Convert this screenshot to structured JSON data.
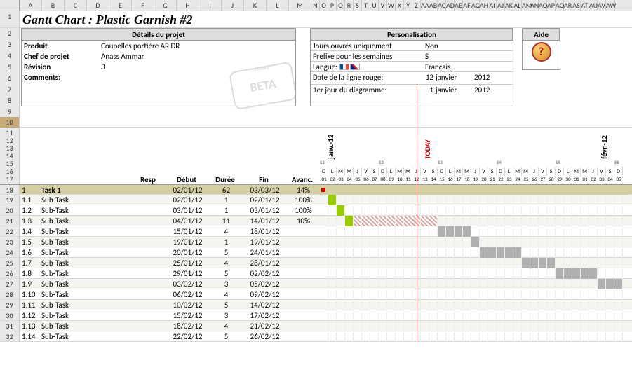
{
  "colHeaders": [
    "A",
    "B",
    "C",
    "D",
    "E",
    "F",
    "G",
    "H",
    "I",
    "J",
    "K",
    "L",
    "M",
    "N",
    "O",
    "P",
    "Q",
    "R",
    "S",
    "T",
    "U",
    "V",
    "W",
    "X",
    "Y",
    "Z",
    "AA",
    "AB",
    "AC",
    "AD",
    "AE",
    "AF",
    "AG",
    "AH",
    "AI",
    "AJ",
    "AK",
    "AL",
    "AM",
    "AN",
    "AO",
    "AP",
    "AQ",
    "AR",
    "AS",
    "AT",
    "AU",
    "AV",
    "AW"
  ],
  "title": "Gantt Chart : Plastic Garnish #2",
  "details": {
    "header": "Détails du projet",
    "product_label": "Produit",
    "product_value": "Coupelles portière AR DR",
    "pm_label": "Chef de projet",
    "pm_value": "Anass Ammar",
    "rev_label": "Révision",
    "rev_value": "3",
    "comments_label": "Comments:"
  },
  "personal": {
    "header": "Personalisation",
    "workdays_label": "Jours ouvrés uniquement",
    "workdays_value": "Non",
    "prefix_label": "Prefixe pour les semaines",
    "prefix_value": "S",
    "lang_label": "Langue:",
    "lang_value": "Français",
    "redline_label": "Date de la ligne rouge:",
    "redline_day": "12",
    "redline_month": "janvier",
    "redline_year": "2012",
    "firstday_label": "1er jour du diagramme:",
    "firstday_day": "1",
    "firstday_month": "janvier",
    "firstday_year": "2012"
  },
  "help": {
    "header": "Aide"
  },
  "betaStamp": "BETA",
  "ganttHeaders": {
    "resp": "Resp",
    "debut": "Début",
    "duree": "Durée",
    "fin": "Fin",
    "avanc": "Avanc."
  },
  "months": {
    "jan": "janv.-12",
    "today": "TODAY",
    "feb": "févr.-12"
  },
  "weekdays": [
    "D",
    "L",
    "M",
    "M",
    "J",
    "V",
    "S"
  ],
  "tasks": [
    {
      "row": 18,
      "idx": "1",
      "name": "Task 1",
      "debut": "02/01/12",
      "duree": "62",
      "fin": "03/03/12",
      "avanc": "14%",
      "header": true
    },
    {
      "row": 19,
      "idx": "1.1",
      "name": "Sub-Task",
      "debut": "02/01/12",
      "duree": "1",
      "fin": "02/01/12",
      "avanc": "100%",
      "barStart": 1,
      "barLen": 1,
      "barType": "green"
    },
    {
      "row": 20,
      "idx": "1.2",
      "name": "Sub-Task",
      "debut": "03/01/12",
      "duree": "1",
      "fin": "03/01/12",
      "avanc": "100%",
      "barStart": 2,
      "barLen": 1,
      "barType": "green"
    },
    {
      "row": 21,
      "idx": "1.3",
      "name": "Sub-Task",
      "debut": "04/01/12",
      "duree": "11",
      "fin": "14/01/12",
      "avanc": "10%",
      "barStart": 3,
      "barLen": 1,
      "barType": "green",
      "bar2Start": 4,
      "bar2Len": 10,
      "bar2Type": "stripe"
    },
    {
      "row": 22,
      "idx": "1.4",
      "name": "Sub-Task",
      "debut": "15/01/12",
      "duree": "4",
      "fin": "18/01/12",
      "avanc": "",
      "barStart": 14,
      "barLen": 4,
      "barType": "gray"
    },
    {
      "row": 23,
      "idx": "1.5",
      "name": "Sub-Task",
      "debut": "19/01/12",
      "duree": "1",
      "fin": "19/01/12",
      "avanc": "",
      "barStart": 18,
      "barLen": 1,
      "barType": "gray"
    },
    {
      "row": 24,
      "idx": "1.6",
      "name": "Sub-Task",
      "debut": "20/01/12",
      "duree": "5",
      "fin": "24/01/12",
      "avanc": "",
      "barStart": 19,
      "barLen": 5,
      "barType": "gray"
    },
    {
      "row": 25,
      "idx": "1.7",
      "name": "Sub-Task",
      "debut": "25/01/12",
      "duree": "4",
      "fin": "28/01/12",
      "avanc": "",
      "barStart": 24,
      "barLen": 4,
      "barType": "gray"
    },
    {
      "row": 26,
      "idx": "1.8",
      "name": "Sub-Task",
      "debut": "29/01/12",
      "duree": "5",
      "fin": "02/02/12",
      "avanc": "",
      "barStart": 28,
      "barLen": 5,
      "barType": "gray"
    },
    {
      "row": 27,
      "idx": "1.9",
      "name": "Sub-Task",
      "debut": "03/02/12",
      "duree": "3",
      "fin": "05/02/12",
      "avanc": "",
      "barStart": 33,
      "barLen": 3,
      "barType": "gray"
    },
    {
      "row": 28,
      "idx": "1.10",
      "name": "Sub-Task",
      "debut": "06/02/12",
      "duree": "4",
      "fin": "09/02/12",
      "avanc": ""
    },
    {
      "row": 29,
      "idx": "1.11",
      "name": "Sub-Task",
      "debut": "10/02/12",
      "duree": "5",
      "fin": "14/02/12",
      "avanc": ""
    },
    {
      "row": 30,
      "idx": "1.12",
      "name": "Sub-Task",
      "debut": "15/02/12",
      "duree": "3",
      "fin": "17/02/12",
      "avanc": ""
    },
    {
      "row": 31,
      "idx": "1.13",
      "name": "Sub-Task",
      "debut": "18/02/12",
      "duree": "4",
      "fin": "21/02/12",
      "avanc": ""
    },
    {
      "row": 32,
      "idx": "1.14",
      "name": "Sub-Task",
      "debut": "22/02/12",
      "duree": "5",
      "fin": "26/02/12",
      "avanc": ""
    }
  ],
  "chart_data": {
    "type": "gantt",
    "title": "Gantt Chart : Plastic Garnish #2",
    "start_date": "01/01/2012",
    "today_date": "12/01/2012",
    "tasks": [
      {
        "id": "1",
        "name": "Task 1",
        "start": "02/01/12",
        "duration": 62,
        "end": "03/03/12",
        "progress": 0.14
      },
      {
        "id": "1.1",
        "name": "Sub-Task",
        "start": "02/01/12",
        "duration": 1,
        "end": "02/01/12",
        "progress": 1.0
      },
      {
        "id": "1.2",
        "name": "Sub-Task",
        "start": "03/01/12",
        "duration": 1,
        "end": "03/01/12",
        "progress": 1.0
      },
      {
        "id": "1.3",
        "name": "Sub-Task",
        "start": "04/01/12",
        "duration": 11,
        "end": "14/01/12",
        "progress": 0.1
      },
      {
        "id": "1.4",
        "name": "Sub-Task",
        "start": "15/01/12",
        "duration": 4,
        "end": "18/01/12",
        "progress": 0
      },
      {
        "id": "1.5",
        "name": "Sub-Task",
        "start": "19/01/12",
        "duration": 1,
        "end": "19/01/12",
        "progress": 0
      },
      {
        "id": "1.6",
        "name": "Sub-Task",
        "start": "20/01/12",
        "duration": 5,
        "end": "24/01/12",
        "progress": 0
      },
      {
        "id": "1.7",
        "name": "Sub-Task",
        "start": "25/01/12",
        "duration": 4,
        "end": "28/01/12",
        "progress": 0
      },
      {
        "id": "1.8",
        "name": "Sub-Task",
        "start": "29/01/12",
        "duration": 5,
        "end": "02/02/12",
        "progress": 0
      },
      {
        "id": "1.9",
        "name": "Sub-Task",
        "start": "03/02/12",
        "duration": 3,
        "end": "05/02/12",
        "progress": 0
      },
      {
        "id": "1.10",
        "name": "Sub-Task",
        "start": "06/02/12",
        "duration": 4,
        "end": "09/02/12",
        "progress": 0
      },
      {
        "id": "1.11",
        "name": "Sub-Task",
        "start": "10/02/12",
        "duration": 5,
        "end": "14/02/12",
        "progress": 0
      },
      {
        "id": "1.12",
        "name": "Sub-Task",
        "start": "15/02/12",
        "duration": 3,
        "end": "17/02/12",
        "progress": 0
      },
      {
        "id": "1.13",
        "name": "Sub-Task",
        "start": "18/02/12",
        "duration": 4,
        "end": "21/02/12",
        "progress": 0
      },
      {
        "id": "1.14",
        "name": "Sub-Task",
        "start": "22/02/12",
        "duration": 5,
        "end": "26/02/12",
        "progress": 0
      }
    ]
  }
}
